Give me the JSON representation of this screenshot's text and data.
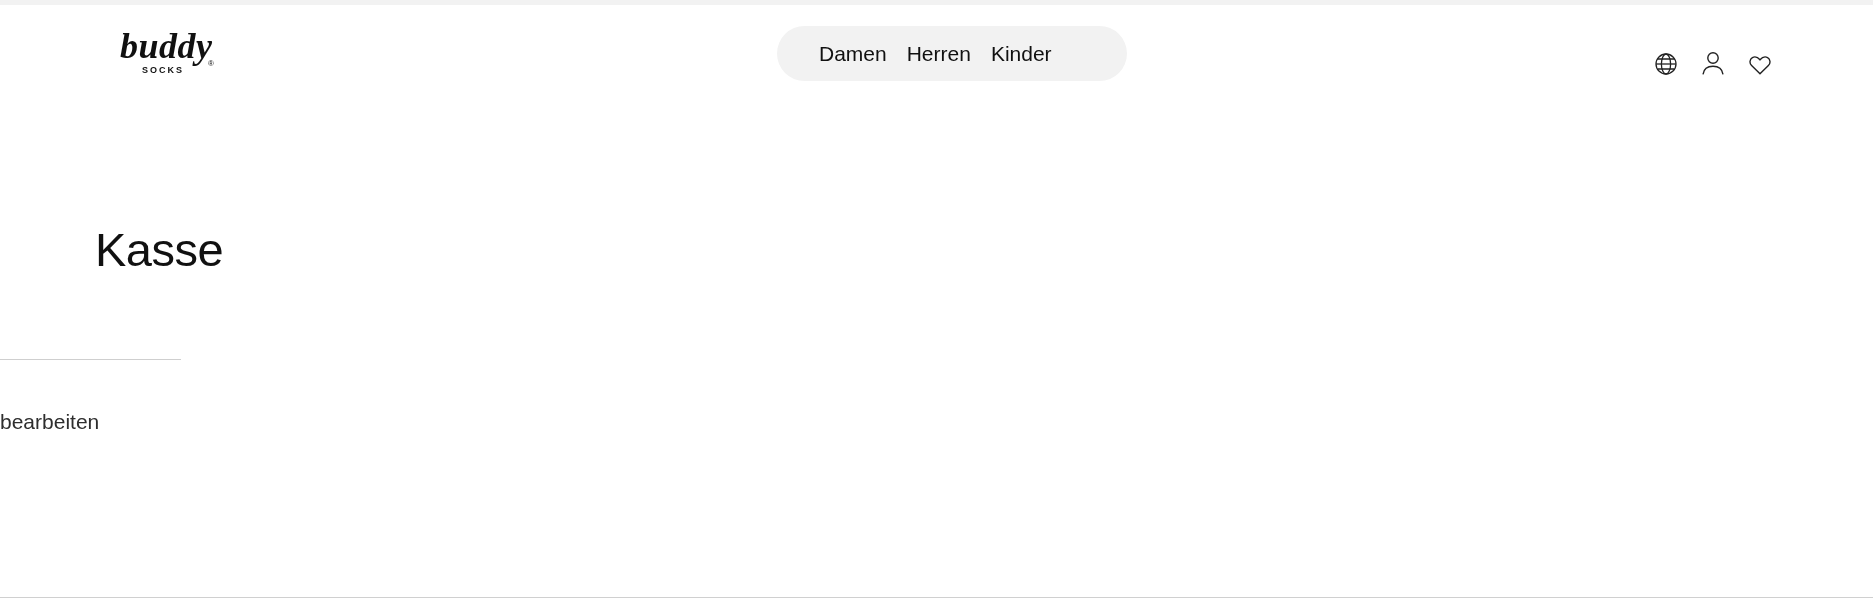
{
  "header": {
    "logo": {
      "wordmark": "buddy",
      "tagline": "SOCKS",
      "mark": "®"
    },
    "nav": [
      {
        "label": "Damen"
      },
      {
        "label": "Herren"
      },
      {
        "label": "Kinder"
      }
    ],
    "icons": [
      {
        "kind": "globe"
      },
      {
        "kind": "person"
      },
      {
        "kind": "heart"
      }
    ]
  },
  "page": {
    "title": "Kasse",
    "edit_link": "bearbeiten"
  }
}
